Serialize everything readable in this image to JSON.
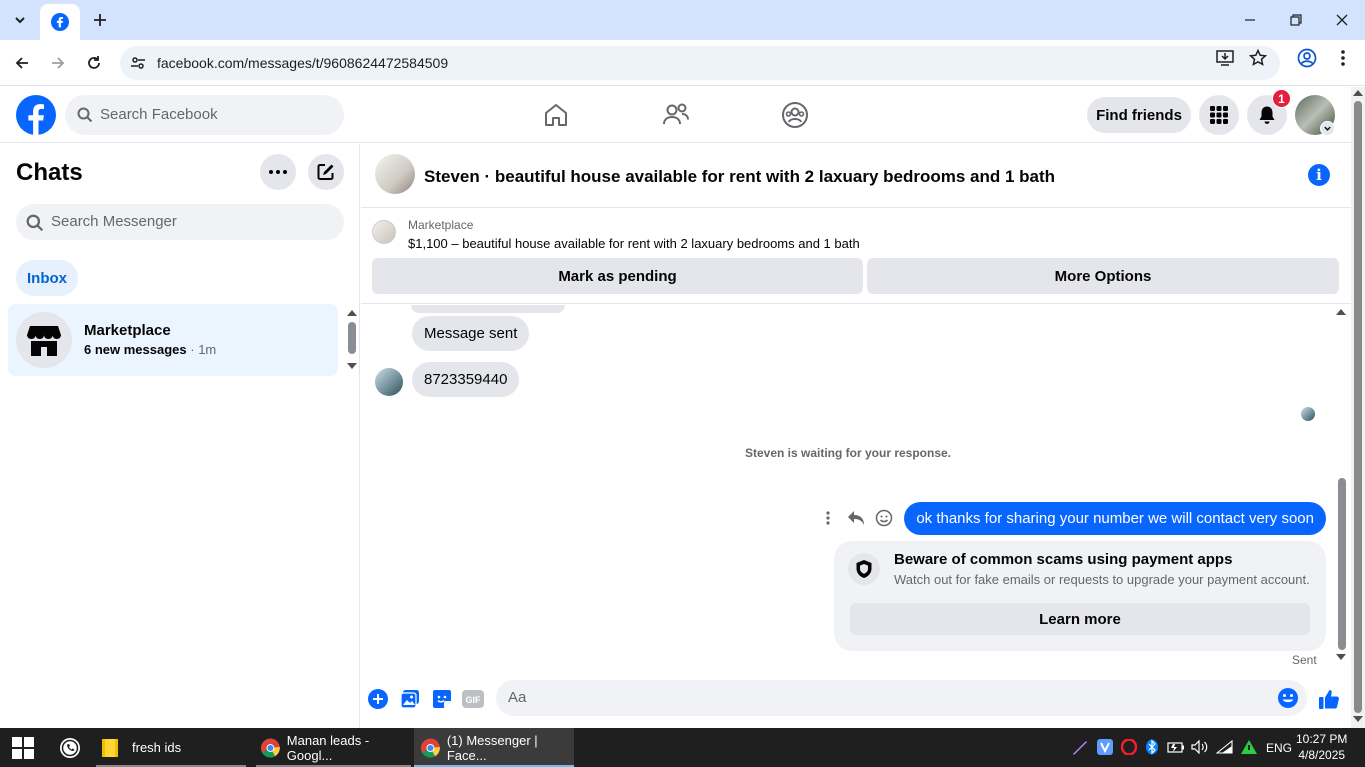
{
  "browser": {
    "url": "facebook.com/messages/t/9608624472584509"
  },
  "fb": {
    "search_placeholder": "Search Facebook",
    "find_friends": "Find friends",
    "notification_count": "1"
  },
  "chats": {
    "title": "Chats",
    "search_placeholder": "Search Messenger",
    "inbox_label": "Inbox",
    "items": [
      {
        "name": "Marketplace",
        "preview": "6 new messages",
        "time": "· 1m"
      }
    ]
  },
  "conversation": {
    "title": "Steven · beautiful house available for rent with 2 laxuary bedrooms and 1 bath",
    "marketplace_label": "Marketplace",
    "listing": "$1,100 – beautiful house available for rent with 2 laxuary bedrooms and 1 bath",
    "mark_pending": "Mark as pending",
    "more_options": "More Options",
    "messages": [
      {
        "text": "Message sent"
      },
      {
        "text": "8723359440"
      }
    ],
    "waiting_text": "Steven is waiting for your response.",
    "my_message": "ok thanks for sharing your number we will contact very soon",
    "scam_title": "Beware of common scams using payment apps",
    "scam_desc": "Watch out for fake emails or requests to upgrade your payment account.",
    "learn_more": "Learn more",
    "status": "Sent",
    "composer_placeholder": "Aa",
    "gif_label": "GIF"
  },
  "taskbar": {
    "items": [
      {
        "label": "fresh ids"
      },
      {
        "label": "Manan leads - Googl..."
      },
      {
        "label": "(1) Messenger | Face..."
      }
    ],
    "language": "ENG",
    "time": "10:27 PM",
    "date": "4/8/2025"
  },
  "colors": {
    "fb_blue": "#0866ff",
    "tabstrip": "#d3e3fd",
    "badge_red": "#e41e3f"
  }
}
